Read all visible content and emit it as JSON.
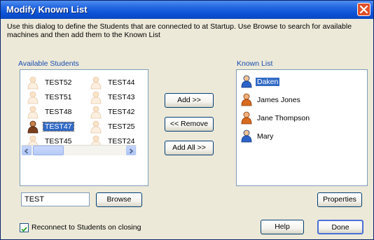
{
  "window": {
    "title": "Modify Known List"
  },
  "description": "Use this dialog to define the Students that are connected to at Startup. Use Browse to search for available machines and then add them to the Known List",
  "available": {
    "label": "Available Students",
    "items": [
      {
        "label": "TEST52",
        "icon": "person-icon-faded",
        "selected": false
      },
      {
        "label": "TEST44",
        "icon": "person-icon-faded",
        "selected": false
      },
      {
        "label": "TEST51",
        "icon": "person-icon-faded",
        "selected": false
      },
      {
        "label": "TEST43",
        "icon": "person-icon-faded",
        "selected": false
      },
      {
        "label": "TEST48",
        "icon": "person-icon-faded",
        "selected": false
      },
      {
        "label": "TEST42",
        "icon": "person-icon-faded",
        "selected": false
      },
      {
        "label": "TEST47",
        "icon": "person-icon-active",
        "selected": true
      },
      {
        "label": "TEST25",
        "icon": "person-icon-faded",
        "selected": false
      },
      {
        "label": "TEST45",
        "icon": "person-icon-faded",
        "selected": false
      },
      {
        "label": "TEST24",
        "icon": "person-icon-faded",
        "selected": false
      }
    ]
  },
  "filter": {
    "value": "TEST",
    "browse_label": "Browse"
  },
  "actions": {
    "add_label": "Add >>",
    "remove_label": "<< Remove",
    "add_all_label": "Add All >>"
  },
  "known": {
    "label": "Known List",
    "items": [
      {
        "label": "Daken",
        "icon": "person-blue-icon",
        "selected": true
      },
      {
        "label": "James Jones",
        "icon": "person-orange-icon",
        "selected": false
      },
      {
        "label": "Jane Thompson",
        "icon": "person-orange-icon",
        "selected": false
      },
      {
        "label": "Mary",
        "icon": "person-blue-icon",
        "selected": false
      }
    ],
    "properties_label": "Properties"
  },
  "footer": {
    "reconnect_label": "Reconnect to Students on closing",
    "reconnect_checked": true,
    "help_label": "Help",
    "done_label": "Done"
  },
  "colors": {
    "titlebar": "#0b52d6",
    "selection": "#316ac5",
    "group_label": "#1a4db0",
    "close_button": "#e0502a"
  }
}
